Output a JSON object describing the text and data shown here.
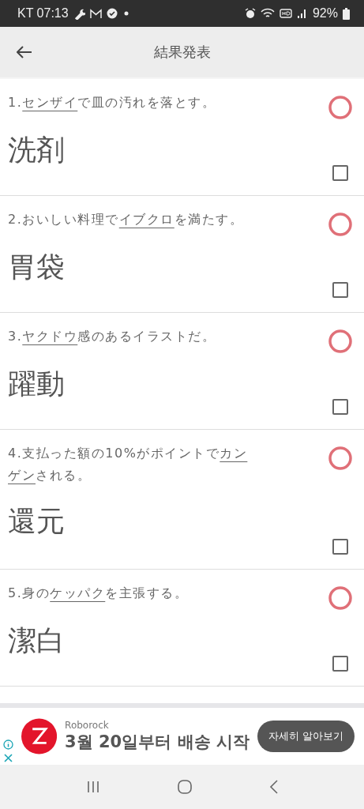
{
  "status_bar": {
    "carrier_time": "KT 07:13",
    "battery": "92%"
  },
  "app_bar": {
    "title": "結果発表"
  },
  "questions": [
    {
      "before": "1.",
      "underlined": "センザイ",
      "after": "で皿の汚れを落とす。",
      "answer": "洗剤",
      "correct": true,
      "checked": false
    },
    {
      "before": "2.おいしい料理で",
      "underlined": "イブクロ",
      "after": "を満たす。",
      "answer": "胃袋",
      "correct": true,
      "checked": false
    },
    {
      "before": "3.",
      "underlined": "ヤクドウ",
      "after": "感のあるイラストだ。",
      "answer": "躍動",
      "correct": true,
      "checked": false
    },
    {
      "before": "4.支払った額の10%がポイントで",
      "underlined": "カンゲン",
      "after": "される。",
      "answer": "還元",
      "correct": true,
      "checked": false
    },
    {
      "before": "5.身の",
      "underlined": "ケッパク",
      "after": "を主張する。",
      "answer": "潔白",
      "correct": true,
      "checked": false
    }
  ],
  "ad": {
    "brand": "Roborock",
    "headline": "3월 20일부터 배송 시작",
    "button": "자세히 알아보기"
  }
}
